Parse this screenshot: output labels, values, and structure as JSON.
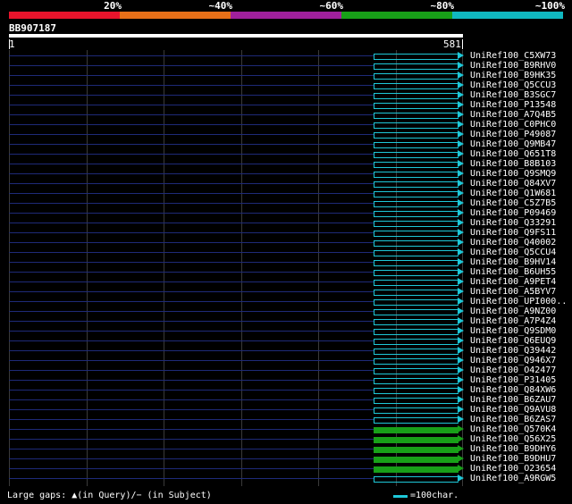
{
  "identity_legend": [
    {
      "label": "20%",
      "color": "#e8142c"
    },
    {
      "label": "~40%",
      "color": "#e87018"
    },
    {
      "label": "~60%",
      "color": "#a0209c"
    },
    {
      "label": "~80%",
      "color": "#18a018"
    },
    {
      "label": "~100%",
      "color": "#10b8c0"
    }
  ],
  "query": {
    "id": "BB907187",
    "start": "1",
    "end": "581"
  },
  "hits": [
    {
      "name": "UniRef100_C5XW73",
      "color": "#1ec8d8"
    },
    {
      "name": "UniRef100_B9RHV0",
      "color": "#1ec8d8"
    },
    {
      "name": "UniRef100_B9HK35",
      "color": "#1ec8d8"
    },
    {
      "name": "UniRef100_Q5CCU3",
      "color": "#1ec8d8"
    },
    {
      "name": "UniRef100_B3SGC7",
      "color": "#1ec8d8"
    },
    {
      "name": "UniRef100_P13548",
      "color": "#1ec8d8"
    },
    {
      "name": "UniRef100_A7Q4B5",
      "color": "#1ec8d8"
    },
    {
      "name": "UniRef100_C0PHC0",
      "color": "#1ec8d8"
    },
    {
      "name": "UniRef100_P49087",
      "color": "#1ec8d8"
    },
    {
      "name": "UniRef100_Q9MB47",
      "color": "#1ec8d8"
    },
    {
      "name": "UniRef100_Q651T8",
      "color": "#1ec8d8"
    },
    {
      "name": "UniRef100_B8B103",
      "color": "#1ec8d8"
    },
    {
      "name": "UniRef100_Q9SMQ9",
      "color": "#1ec8d8"
    },
    {
      "name": "UniRef100_Q84XV7",
      "color": "#1ec8d8"
    },
    {
      "name": "UniRef100_Q1W681",
      "color": "#1ec8d8"
    },
    {
      "name": "UniRef100_C5Z7B5",
      "color": "#1ec8d8"
    },
    {
      "name": "UniRef100_P09469",
      "color": "#1ec8d8"
    },
    {
      "name": "UniRef100_Q33291",
      "color": "#1ec8d8"
    },
    {
      "name": "UniRef100_Q9FS11",
      "color": "#1ec8d8"
    },
    {
      "name": "UniRef100_Q40002",
      "color": "#1ec8d8"
    },
    {
      "name": "UniRef100_Q5CCU4",
      "color": "#1ec8d8"
    },
    {
      "name": "UniRef100_B9HV14",
      "color": "#1ec8d8"
    },
    {
      "name": "UniRef100_B6UH55",
      "color": "#1ec8d8"
    },
    {
      "name": "UniRef100_A9PET4",
      "color": "#1ec8d8"
    },
    {
      "name": "UniRef100_A5BYV7",
      "color": "#1ec8d8"
    },
    {
      "name": "UniRef100_UPI000..",
      "color": "#1ec8d8"
    },
    {
      "name": "UniRef100_A9NZ00",
      "color": "#1ec8d8"
    },
    {
      "name": "UniRef100_A7P4Z4",
      "color": "#1ec8d8"
    },
    {
      "name": "UniRef100_Q9SDM0",
      "color": "#1ec8d8"
    },
    {
      "name": "UniRef100_Q6EUQ9",
      "color": "#1ec8d8"
    },
    {
      "name": "UniRef100_Q39442",
      "color": "#1ec8d8"
    },
    {
      "name": "UniRef100_Q946X7",
      "color": "#1ec8d8"
    },
    {
      "name": "UniRef100_O42477",
      "color": "#1ec8d8"
    },
    {
      "name": "UniRef100_P31405",
      "color": "#1ec8d8"
    },
    {
      "name": "UniRef100_Q84XW6",
      "color": "#1ec8d8"
    },
    {
      "name": "UniRef100_B6ZAU7",
      "color": "#1ec8d8"
    },
    {
      "name": "UniRef100_Q9AVU8",
      "color": "#1ec8d8"
    },
    {
      "name": "UniRef100_B6ZAS7",
      "color": "#1ec8d8"
    },
    {
      "name": "UniRef100_Q570K4",
      "color": "#18a018"
    },
    {
      "name": "UniRef100_Q56X25",
      "color": "#18a018"
    },
    {
      "name": "UniRef100_B9DHY6",
      "color": "#18a018"
    },
    {
      "name": "UniRef100_B9DHU7",
      "color": "#18a018"
    },
    {
      "name": "UniRef100_O23654",
      "color": "#18a018"
    },
    {
      "name": "UniRef100_A9RGW5",
      "color": "#1ec8d8"
    }
  ],
  "footer": {
    "gaps_note": "Large gaps: ▲(in Query)/− (in Subject)",
    "scale_note": "=100char."
  }
}
